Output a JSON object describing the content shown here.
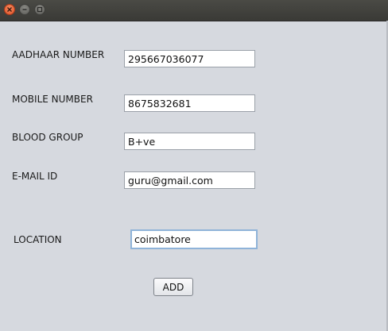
{
  "window": {
    "controls": [
      {
        "name": "close-icon"
      },
      {
        "name": "minimize-icon"
      },
      {
        "name": "maximize-icon"
      }
    ]
  },
  "form": {
    "aadhaar_label": "AADHAAR  NUMBER",
    "aadhaar_value": "295667036077",
    "mobile_label": "MOBILE NUMBER",
    "mobile_value": "8675832681",
    "blood_label": "BLOOD GROUP",
    "blood_value": "B+ve",
    "email_label": "E-MAIL ID",
    "email_value": "guru@gmail.com",
    "location_label": "LOCATION",
    "location_value": "coimbatore",
    "add_label": "ADD"
  }
}
